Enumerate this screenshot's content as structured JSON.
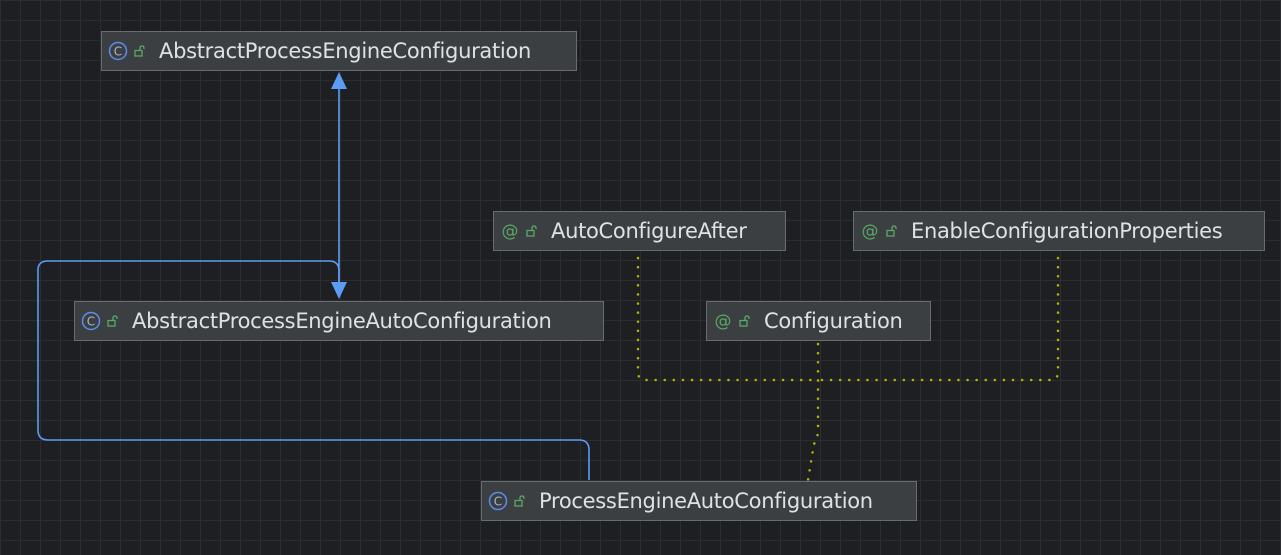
{
  "diagram": {
    "colors": {
      "background": "#1e1f22",
      "grid": "#2b2d30",
      "node_fill": "#3c3f41",
      "node_border": "#6a6d70",
      "label": "#dfe1e5",
      "class_icon": "#5b8def",
      "annotation_icon": "#59a869",
      "lock_icon": "#59a869",
      "inheritance_edge": "#5c9cf5",
      "annotation_edge": "#b3b300"
    },
    "nodes": {
      "abstract_process_engine_configuration": {
        "label": "AbstractProcessEngineConfiguration",
        "kind": "class",
        "icon": "class-icon",
        "visibility_icon": "lock-open-icon"
      },
      "auto_configure_after": {
        "label": "AutoConfigureAfter",
        "kind": "annotation",
        "icon": "annotation-icon",
        "visibility_icon": "lock-open-icon"
      },
      "enable_configuration_properties": {
        "label": "EnableConfigurationProperties",
        "kind": "annotation",
        "icon": "annotation-icon",
        "visibility_icon": "lock-open-icon"
      },
      "abstract_process_engine_auto_configuration": {
        "label": "AbstractProcessEngineAutoConfiguration",
        "kind": "class",
        "icon": "class-icon",
        "visibility_icon": "lock-open-icon"
      },
      "configuration": {
        "label": "Configuration",
        "kind": "annotation",
        "icon": "annotation-icon",
        "visibility_icon": "lock-open-icon"
      },
      "process_engine_auto_configuration": {
        "label": "ProcessEngineAutoConfiguration",
        "kind": "class",
        "icon": "class-icon",
        "visibility_icon": "lock-open-icon"
      }
    },
    "edges": [
      {
        "from": "abstract_process_engine_auto_configuration",
        "to": "abstract_process_engine_configuration",
        "type": "extends"
      },
      {
        "from": "process_engine_auto_configuration",
        "to": "abstract_process_engine_auto_configuration",
        "type": "extends"
      },
      {
        "from": "process_engine_auto_configuration",
        "to": "auto_configure_after",
        "type": "annotated-with"
      },
      {
        "from": "process_engine_auto_configuration",
        "to": "configuration",
        "type": "annotated-with"
      },
      {
        "from": "process_engine_auto_configuration",
        "to": "enable_configuration_properties",
        "type": "annotated-with"
      }
    ]
  }
}
